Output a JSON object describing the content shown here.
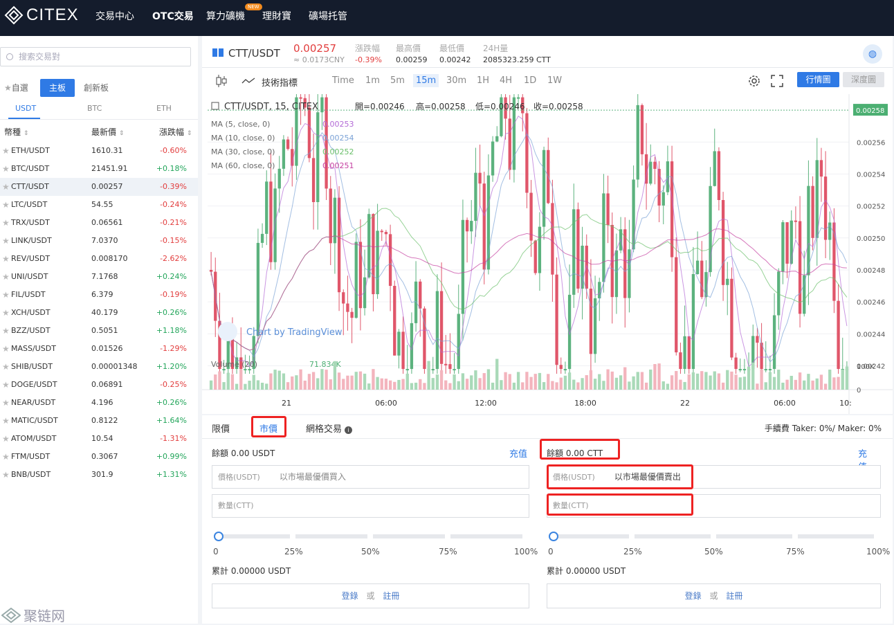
{
  "nav": {
    "logo": "CITEX",
    "items": [
      "交易中心",
      "OTC交易",
      "算力礦機",
      "理財寶",
      "礦場托管"
    ],
    "badge": "NEW"
  },
  "sidebar": {
    "search_placeholder": "搜索交易對",
    "tabs": [
      "自選",
      "主板",
      "創新板"
    ],
    "active_tab": "主板",
    "currencies": [
      "USDT",
      "BTC",
      "ETH"
    ],
    "headers": [
      "幣種",
      "最新價",
      "漲跌幅"
    ],
    "pairs": [
      {
        "pair": "ETH/USDT",
        "price": "1610.31",
        "change": "-0.60%"
      },
      {
        "pair": "BTC/USDT",
        "price": "21451.91",
        "change": "+0.18%"
      },
      {
        "pair": "CTT/USDT",
        "price": "0.00257",
        "change": "-0.39%"
      },
      {
        "pair": "LTC/USDT",
        "price": "54.55",
        "change": "-0.24%"
      },
      {
        "pair": "TRX/USDT",
        "price": "0.06561",
        "change": "-0.21%"
      },
      {
        "pair": "LINK/USDT",
        "price": "7.0370",
        "change": "-0.15%"
      },
      {
        "pair": "REV/USDT",
        "price": "0.008170",
        "change": "-2.62%"
      },
      {
        "pair": "UNI/USDT",
        "price": "7.1768",
        "change": "+0.24%"
      },
      {
        "pair": "FIL/USDT",
        "price": "6.379",
        "change": "-0.19%"
      },
      {
        "pair": "XCH/USDT",
        "price": "40.179",
        "change": "+0.26%"
      },
      {
        "pair": "BZZ/USDT",
        "price": "0.5051",
        "change": "+1.18%"
      },
      {
        "pair": "MASS/USDT",
        "price": "0.01526",
        "change": "-1.29%"
      },
      {
        "pair": "SHIB/USDT",
        "price": "0.00001348",
        "change": "+1.20%"
      },
      {
        "pair": "DOGE/USDT",
        "price": "0.06891",
        "change": "-0.25%"
      },
      {
        "pair": "NEAR/USDT",
        "price": "4.196",
        "change": "+0.26%"
      },
      {
        "pair": "MATIC/USDT",
        "price": "0.8122",
        "change": "+1.64%"
      },
      {
        "pair": "ATOM/USDT",
        "price": "10.54",
        "change": "-1.31%"
      },
      {
        "pair": "FTM/USDT",
        "price": "0.3067",
        "change": "+0.99%"
      },
      {
        "pair": "BNB/USDT",
        "price": "301.9",
        "change": "+1.31%"
      }
    ]
  },
  "ticker": {
    "pair": "CTT/USDT",
    "price": "0.00257",
    "cny": "≈ 0.0173CNY",
    "change_label": "漲跌幅",
    "change": "-0.39%",
    "high_label": "最高價",
    "high": "0.00259",
    "low_label": "最低價",
    "low": "0.00242",
    "vol_label": "24H量",
    "vol": "2085323.259 CTT"
  },
  "toolbar": {
    "indicators": "技術指標",
    "intervals": [
      "Time",
      "1m",
      "5m",
      "15m",
      "30m",
      "1H",
      "4H",
      "1D",
      "1W"
    ],
    "active_interval": "15m",
    "btn_quote": "行情圖",
    "btn_depth": "深度圖"
  },
  "chart_data": {
    "type": "candlestick",
    "symbol_line": "CTT/USDT, 15, CITEX",
    "ohlc_labels": {
      "open": "開=0.00246",
      "high": "高=0.00258",
      "low": "低=0.00246",
      "close": "收=0.00258"
    },
    "ma": [
      {
        "name": "MA (5, close, 0)",
        "value": "0.00253",
        "color": "#b36ad6"
      },
      {
        "name": "MA (10, close, 0)",
        "value": "0.00254",
        "color": "#7ba2d6"
      },
      {
        "name": "MA (30, close, 0)",
        "value": "0.00252",
        "color": "#6abf6a"
      },
      {
        "name": "MA (60, close, 0)",
        "value": "0.00251",
        "color": "#c43fa0"
      }
    ],
    "y_ticks": [
      "0.00256",
      "0.00254",
      "0.00252",
      "0.00250",
      "0.00248",
      "0.00246",
      "0.00244",
      "0.00242"
    ],
    "ylim": [
      0.002415,
      0.00259
    ],
    "last_price": "0.00258",
    "x_ticks": [
      "21",
      "06:00",
      "12:00",
      "18:00",
      "22",
      "06:00",
      "10:"
    ],
    "watermark": "Chart by TradingView",
    "volume_label": "Volume (20)",
    "volume_value": "71.834K",
    "volume_ticks": [
      "100K",
      "0"
    ],
    "up_color": "#5cb27e",
    "down_color": "#e0566a"
  },
  "order": {
    "tabs": [
      "限價",
      "市價",
      "網格交易"
    ],
    "active": "市價",
    "fee": "手續費 Taker: 0%/ Maker: 0%",
    "buy": {
      "balance_label": "餘額",
      "balance": "0.00  USDT",
      "deposit": "充值",
      "price_label": "價格(USDT)",
      "price_hint": "以市場最優價買入",
      "qty_label": "數量(CTT)",
      "total": "累計 0.00000 USDT",
      "login": "登錄",
      "or": "或",
      "register": "註冊"
    },
    "sell": {
      "balance_label": "餘額",
      "balance": "0.00  CTT",
      "deposit": "充值",
      "price_label": "價格(USDT)",
      "price_hint": "以市場最優價賣出",
      "qty_label": "數量(CTT)",
      "total": "累計 0.00000 USDT",
      "login": "登錄",
      "or": "或",
      "register": "註冊"
    },
    "percents": [
      "0",
      "25%",
      "50%",
      "75%",
      "100%"
    ]
  },
  "watermark_site": "聚链网"
}
